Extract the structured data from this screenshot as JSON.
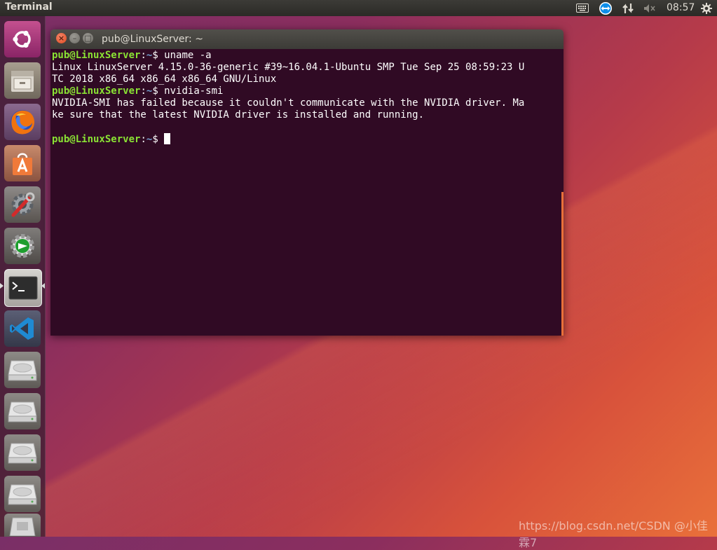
{
  "top_panel": {
    "app_name": "Terminal",
    "clock": "08:57",
    "tray_icons": [
      "keyboard-icon",
      "teamviewer-icon",
      "network-icon",
      "volume-muted-icon",
      "settings-gear-icon"
    ]
  },
  "launcher": {
    "items": [
      {
        "name": "ubuntu-dash-icon"
      },
      {
        "name": "files-icon"
      },
      {
        "name": "firefox-icon"
      },
      {
        "name": "software-center-icon"
      },
      {
        "name": "system-settings-icon"
      },
      {
        "name": "update-manager-icon"
      },
      {
        "name": "terminal-icon",
        "active": true
      },
      {
        "name": "vscode-icon"
      },
      {
        "name": "drive-icon"
      },
      {
        "name": "drive-icon"
      },
      {
        "name": "drive-icon"
      },
      {
        "name": "drive-icon"
      },
      {
        "name": "trash-icon"
      }
    ]
  },
  "window": {
    "title": "pub@LinuxServer: ~",
    "close_glyph": "×",
    "min_glyph": "–",
    "max_glyph": "□"
  },
  "terminal": {
    "prompt_user": "pub@LinuxServer",
    "prompt_path": "~",
    "lines": [
      {
        "type": "cmd",
        "cmd": "uname -a"
      },
      {
        "type": "out",
        "text": "Linux LinuxServer 4.15.0-36-generic #39~16.04.1-Ubuntu SMP Tue Sep 25 08:59:23 U"
      },
      {
        "type": "out",
        "text": "TC 2018 x86_64 x86_64 x86_64 GNU/Linux"
      },
      {
        "type": "cmd",
        "cmd": "nvidia-smi"
      },
      {
        "type": "out",
        "text": "NVIDIA-SMI has failed because it couldn't communicate with the NVIDIA driver. Ma"
      },
      {
        "type": "out",
        "text": "ke sure that the latest NVIDIA driver is installed and running."
      },
      {
        "type": "out",
        "text": ""
      },
      {
        "type": "cmd",
        "cmd": "",
        "cursor": true
      }
    ]
  },
  "watermark": "https://blog.csdn.net/CSDN @小佳霖7"
}
